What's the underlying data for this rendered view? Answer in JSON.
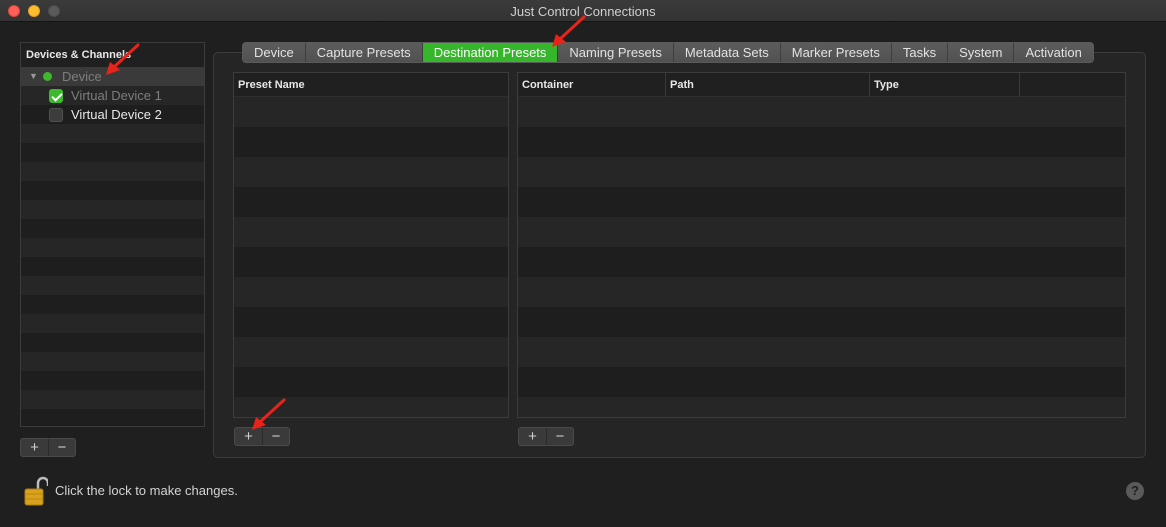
{
  "window": {
    "title": "Just Control Connections"
  },
  "devices": {
    "header": "Devices & Channels",
    "device_label": "Device",
    "channels": [
      {
        "label": "Virtual Device 1",
        "checked": true
      },
      {
        "label": "Virtual Device 2",
        "checked": false
      }
    ],
    "add_symbol": "+",
    "remove_symbol": "−"
  },
  "tabs": [
    {
      "label": "Device",
      "active": false
    },
    {
      "label": "Capture Presets",
      "active": false
    },
    {
      "label": "Destination Presets",
      "active": true
    },
    {
      "label": "Naming Presets",
      "active": false
    },
    {
      "label": "Metadata Sets",
      "active": false
    },
    {
      "label": "Marker Presets",
      "active": false
    },
    {
      "label": "Tasks",
      "active": false
    },
    {
      "label": "System",
      "active": false
    },
    {
      "label": "Activation",
      "active": false
    }
  ],
  "presets_table": {
    "columns": [
      "Preset Name"
    ]
  },
  "destinations_table": {
    "columns": [
      "Container",
      "Path",
      "Type",
      ""
    ]
  },
  "buttons": {
    "add": "+",
    "remove": "−"
  },
  "footer": {
    "lock_text": "Click the lock to make changes.",
    "help": "?"
  },
  "colors": {
    "accent": "#36b62a",
    "status_green": "#3dba2b",
    "annotation_red": "#e8241a"
  }
}
